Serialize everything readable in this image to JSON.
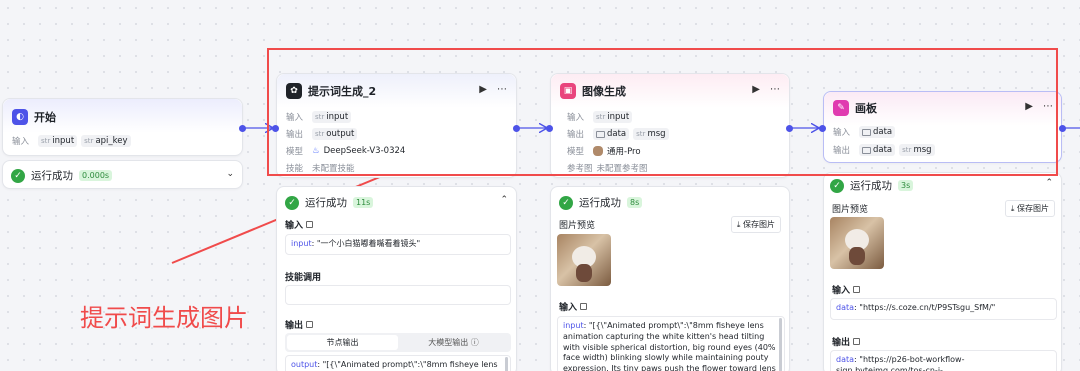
{
  "start": {
    "title": "开始",
    "input_label": "输入",
    "inputs": [
      {
        "type": "str",
        "name": "input"
      },
      {
        "type": "str",
        "name": "api_key"
      }
    ],
    "status": "运行成功",
    "duration": "0.000s"
  },
  "prompt_node": {
    "title": "提示词生成_2",
    "input_label": "输入",
    "input": {
      "type": "str",
      "name": "input"
    },
    "output_label": "输出",
    "output": {
      "type": "str",
      "name": "output"
    },
    "model_label": "模型",
    "model": "DeepSeek-V3-0324",
    "skills_label": "技能",
    "skills": "未配置技能",
    "status": "运行成功",
    "duration": "11s",
    "result_input_title": "输入",
    "result_input_key": "input",
    "result_input_value": ": \"一个小白猫嘟着嘴看着镜头\"",
    "skill_call_title": "技能调用",
    "result_output_title": "输出",
    "tabs": [
      "节点输出",
      "大模型输出"
    ],
    "output_key": "output",
    "output_value": ": \"[{\\\"Animated prompt\\\":\\\"8mm fisheye lens"
  },
  "image_node": {
    "title": "图像生成",
    "input_label": "输入",
    "input": {
      "type": "str",
      "name": "input"
    },
    "output_label": "输出",
    "outputs": [
      {
        "type": "img",
        "name": "data"
      },
      {
        "type": "str",
        "name": "msg"
      }
    ],
    "model_label": "模型",
    "model": "通用-Pro",
    "ref_label": "参考图",
    "ref": "未配置参考图",
    "status": "运行成功",
    "duration": "8s",
    "preview_title": "图片预览",
    "save_label": "保存图片",
    "result_input_title": "输入",
    "input_key": "input",
    "input_value": ": \"[{\\\"Animated prompt\\\":\\\"8mm fisheye lens animation capturing the white kitten's head tilting with visible spherical distortion, big round eyes (40% face width) blinking slowly while maintaining pouty expression. Its tiny paws push the flower toward lens"
  },
  "canvas_node": {
    "title": "画板",
    "input_label": "输入",
    "input": {
      "type": "img",
      "name": "data"
    },
    "output_label": "输出",
    "outputs": [
      {
        "type": "img",
        "name": "data"
      },
      {
        "type": "str",
        "name": "msg"
      }
    ],
    "status": "运行成功",
    "duration": "3s",
    "preview_title": "图片预览",
    "save_label": "保存图片",
    "result_input_title": "输入",
    "input_key": "data",
    "input_value": ": \"https://s.coze.cn/t/P9STsgu_SfM/\"",
    "result_output_title": "输出",
    "output_key": "data",
    "output_value": ": \"https://p26-bot-workflow-sign.byteimg.com/tos-cn-i-"
  },
  "annotation": {
    "text": "提示词生成图片",
    "color": "#f04b4b"
  },
  "colors": {
    "accent": "#4d53e8",
    "success": "#32a645"
  }
}
